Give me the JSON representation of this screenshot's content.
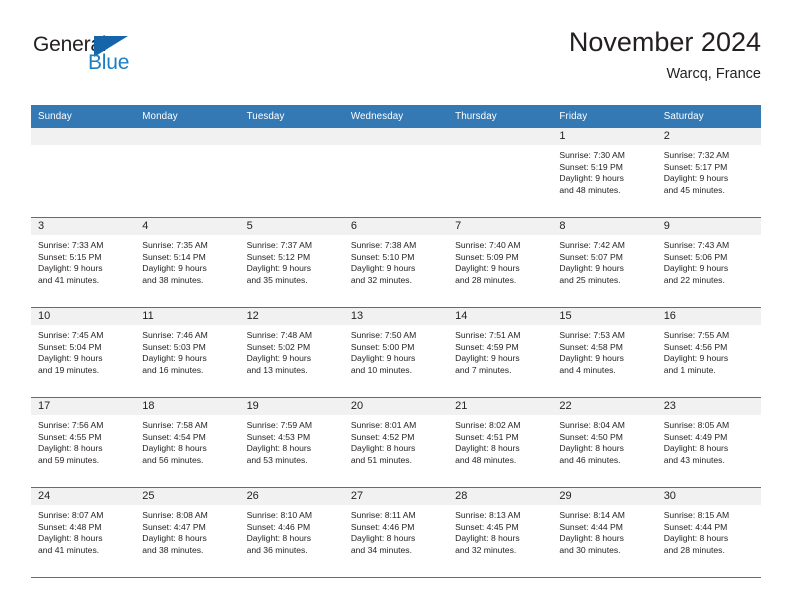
{
  "brand": {
    "name_part1": "General",
    "name_part2": "Blue",
    "triangle_icon": "triangle-logo-icon",
    "color_dark": "#231f20",
    "color_blue": "#1d7fc3"
  },
  "header": {
    "title": "November 2024",
    "location": "Warcq, France"
  },
  "theme": {
    "header_blue": "#3479b4",
    "daynum_band": "#f1f1f1",
    "text": "#231f20"
  },
  "weekdays": [
    "Sunday",
    "Monday",
    "Tuesday",
    "Wednesday",
    "Thursday",
    "Friday",
    "Saturday"
  ],
  "weeks": [
    [
      {
        "day": "",
        "empty": true
      },
      {
        "day": "",
        "empty": true
      },
      {
        "day": "",
        "empty": true
      },
      {
        "day": "",
        "empty": true
      },
      {
        "day": "",
        "empty": true
      },
      {
        "day": "1",
        "sunrise": "Sunrise: 7:30 AM",
        "sunset": "Sunset: 5:19 PM",
        "daylight1": "Daylight: 9 hours",
        "daylight2": "and 48 minutes."
      },
      {
        "day": "2",
        "sunrise": "Sunrise: 7:32 AM",
        "sunset": "Sunset: 5:17 PM",
        "daylight1": "Daylight: 9 hours",
        "daylight2": "and 45 minutes."
      }
    ],
    [
      {
        "day": "3",
        "sunrise": "Sunrise: 7:33 AM",
        "sunset": "Sunset: 5:15 PM",
        "daylight1": "Daylight: 9 hours",
        "daylight2": "and 41 minutes."
      },
      {
        "day": "4",
        "sunrise": "Sunrise: 7:35 AM",
        "sunset": "Sunset: 5:14 PM",
        "daylight1": "Daylight: 9 hours",
        "daylight2": "and 38 minutes."
      },
      {
        "day": "5",
        "sunrise": "Sunrise: 7:37 AM",
        "sunset": "Sunset: 5:12 PM",
        "daylight1": "Daylight: 9 hours",
        "daylight2": "and 35 minutes."
      },
      {
        "day": "6",
        "sunrise": "Sunrise: 7:38 AM",
        "sunset": "Sunset: 5:10 PM",
        "daylight1": "Daylight: 9 hours",
        "daylight2": "and 32 minutes."
      },
      {
        "day": "7",
        "sunrise": "Sunrise: 7:40 AM",
        "sunset": "Sunset: 5:09 PM",
        "daylight1": "Daylight: 9 hours",
        "daylight2": "and 28 minutes."
      },
      {
        "day": "8",
        "sunrise": "Sunrise: 7:42 AM",
        "sunset": "Sunset: 5:07 PM",
        "daylight1": "Daylight: 9 hours",
        "daylight2": "and 25 minutes."
      },
      {
        "day": "9",
        "sunrise": "Sunrise: 7:43 AM",
        "sunset": "Sunset: 5:06 PM",
        "daylight1": "Daylight: 9 hours",
        "daylight2": "and 22 minutes."
      }
    ],
    [
      {
        "day": "10",
        "sunrise": "Sunrise: 7:45 AM",
        "sunset": "Sunset: 5:04 PM",
        "daylight1": "Daylight: 9 hours",
        "daylight2": "and 19 minutes."
      },
      {
        "day": "11",
        "sunrise": "Sunrise: 7:46 AM",
        "sunset": "Sunset: 5:03 PM",
        "daylight1": "Daylight: 9 hours",
        "daylight2": "and 16 minutes."
      },
      {
        "day": "12",
        "sunrise": "Sunrise: 7:48 AM",
        "sunset": "Sunset: 5:02 PM",
        "daylight1": "Daylight: 9 hours",
        "daylight2": "and 13 minutes."
      },
      {
        "day": "13",
        "sunrise": "Sunrise: 7:50 AM",
        "sunset": "Sunset: 5:00 PM",
        "daylight1": "Daylight: 9 hours",
        "daylight2": "and 10 minutes."
      },
      {
        "day": "14",
        "sunrise": "Sunrise: 7:51 AM",
        "sunset": "Sunset: 4:59 PM",
        "daylight1": "Daylight: 9 hours",
        "daylight2": "and 7 minutes."
      },
      {
        "day": "15",
        "sunrise": "Sunrise: 7:53 AM",
        "sunset": "Sunset: 4:58 PM",
        "daylight1": "Daylight: 9 hours",
        "daylight2": "and 4 minutes."
      },
      {
        "day": "16",
        "sunrise": "Sunrise: 7:55 AM",
        "sunset": "Sunset: 4:56 PM",
        "daylight1": "Daylight: 9 hours",
        "daylight2": "and 1 minute."
      }
    ],
    [
      {
        "day": "17",
        "sunrise": "Sunrise: 7:56 AM",
        "sunset": "Sunset: 4:55 PM",
        "daylight1": "Daylight: 8 hours",
        "daylight2": "and 59 minutes."
      },
      {
        "day": "18",
        "sunrise": "Sunrise: 7:58 AM",
        "sunset": "Sunset: 4:54 PM",
        "daylight1": "Daylight: 8 hours",
        "daylight2": "and 56 minutes."
      },
      {
        "day": "19",
        "sunrise": "Sunrise: 7:59 AM",
        "sunset": "Sunset: 4:53 PM",
        "daylight1": "Daylight: 8 hours",
        "daylight2": "and 53 minutes."
      },
      {
        "day": "20",
        "sunrise": "Sunrise: 8:01 AM",
        "sunset": "Sunset: 4:52 PM",
        "daylight1": "Daylight: 8 hours",
        "daylight2": "and 51 minutes."
      },
      {
        "day": "21",
        "sunrise": "Sunrise: 8:02 AM",
        "sunset": "Sunset: 4:51 PM",
        "daylight1": "Daylight: 8 hours",
        "daylight2": "and 48 minutes."
      },
      {
        "day": "22",
        "sunrise": "Sunrise: 8:04 AM",
        "sunset": "Sunset: 4:50 PM",
        "daylight1": "Daylight: 8 hours",
        "daylight2": "and 46 minutes."
      },
      {
        "day": "23",
        "sunrise": "Sunrise: 8:05 AM",
        "sunset": "Sunset: 4:49 PM",
        "daylight1": "Daylight: 8 hours",
        "daylight2": "and 43 minutes."
      }
    ],
    [
      {
        "day": "24",
        "sunrise": "Sunrise: 8:07 AM",
        "sunset": "Sunset: 4:48 PM",
        "daylight1": "Daylight: 8 hours",
        "daylight2": "and 41 minutes."
      },
      {
        "day": "25",
        "sunrise": "Sunrise: 8:08 AM",
        "sunset": "Sunset: 4:47 PM",
        "daylight1": "Daylight: 8 hours",
        "daylight2": "and 38 minutes."
      },
      {
        "day": "26",
        "sunrise": "Sunrise: 8:10 AM",
        "sunset": "Sunset: 4:46 PM",
        "daylight1": "Daylight: 8 hours",
        "daylight2": "and 36 minutes."
      },
      {
        "day": "27",
        "sunrise": "Sunrise: 8:11 AM",
        "sunset": "Sunset: 4:46 PM",
        "daylight1": "Daylight: 8 hours",
        "daylight2": "and 34 minutes."
      },
      {
        "day": "28",
        "sunrise": "Sunrise: 8:13 AM",
        "sunset": "Sunset: 4:45 PM",
        "daylight1": "Daylight: 8 hours",
        "daylight2": "and 32 minutes."
      },
      {
        "day": "29",
        "sunrise": "Sunrise: 8:14 AM",
        "sunset": "Sunset: 4:44 PM",
        "daylight1": "Daylight: 8 hours",
        "daylight2": "and 30 minutes."
      },
      {
        "day": "30",
        "sunrise": "Sunrise: 8:15 AM",
        "sunset": "Sunset: 4:44 PM",
        "daylight1": "Daylight: 8 hours",
        "daylight2": "and 28 minutes."
      }
    ]
  ]
}
